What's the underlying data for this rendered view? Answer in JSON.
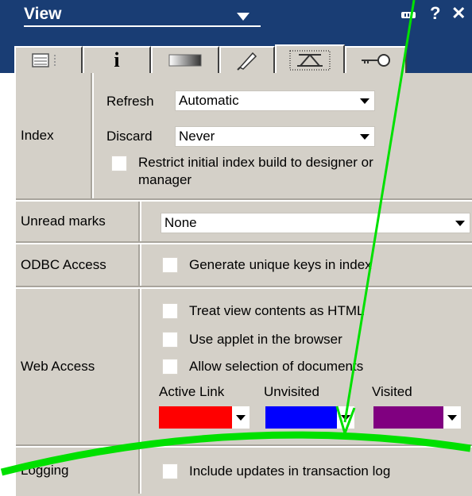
{
  "window": {
    "title": "View",
    "help_glyph": "?",
    "close_glyph": "✕"
  },
  "tabs": [
    {
      "icon": "basics-list-icon"
    },
    {
      "icon": "info-icon",
      "glyph": "i"
    },
    {
      "icon": "style-gradient-icon"
    },
    {
      "icon": "font-pen-icon"
    },
    {
      "icon": "advanced-index-icon"
    },
    {
      "icon": "security-key-icon"
    }
  ],
  "index": {
    "label": "Index",
    "refresh_label": "Refresh",
    "refresh_value": "Automatic",
    "discard_label": "Discard",
    "discard_value": "Never",
    "restrict_line1": "Restrict initial index build to designer or",
    "restrict_line2": "manager"
  },
  "unread": {
    "label": "Unread marks",
    "value": "None"
  },
  "odbc": {
    "label": "ODBC Access",
    "generate_unique": "Generate unique keys in index"
  },
  "web": {
    "label": "Web Access",
    "treat_html": "Treat view contents as HTML",
    "use_applet": "Use applet in the browser",
    "allow_selection": "Allow selection of documents",
    "active_link_label": "Active Link",
    "unvisited_label": "Unvisited",
    "visited_label": "Visited",
    "active_link_color": "#ff0000",
    "unvisited_color": "#0000ff",
    "visited_color": "#800080"
  },
  "logging": {
    "label": "Logging",
    "include_updates": "Include updates in transaction log"
  },
  "colors": {
    "titlebar": "#193d74",
    "panel": "#d4d0c8",
    "annotation": "#00e000"
  }
}
